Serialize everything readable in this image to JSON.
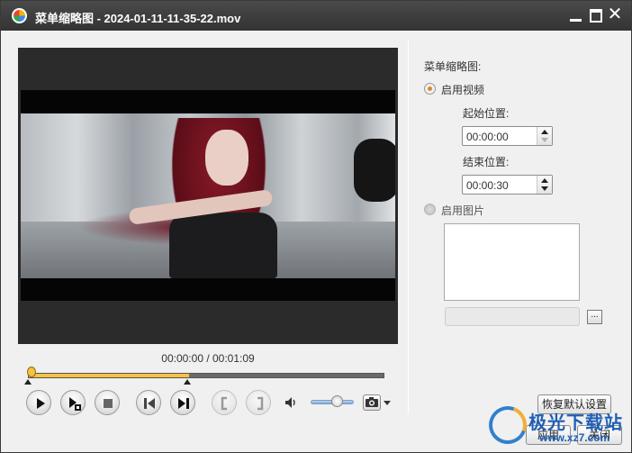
{
  "window": {
    "title": "菜单缩略图 - 2024-01-11-11-35-22.mov"
  },
  "player": {
    "time_display": "00:00:00 / 00:01:09",
    "volume_level": 0.6
  },
  "settings": {
    "section_label": "菜单缩略图:",
    "use_video": {
      "label": "启用视频",
      "selected": true
    },
    "start_position": {
      "label": "起始位置:",
      "value": "00:00:00"
    },
    "end_position": {
      "label": "结束位置:",
      "value": "00:00:30"
    },
    "use_image": {
      "label": "启用图片",
      "selected": false
    },
    "browse_label": "..."
  },
  "buttons": {
    "restore_defaults": "恢复默认设置",
    "apply": "应用",
    "close": "关闭"
  },
  "watermark": {
    "title": "极光下载站",
    "url": "www.xz7.com"
  },
  "colors": {
    "accent_yellow": "#f5c243",
    "titlebar": "#333333",
    "watermark_blue": "#1f5fb4"
  }
}
